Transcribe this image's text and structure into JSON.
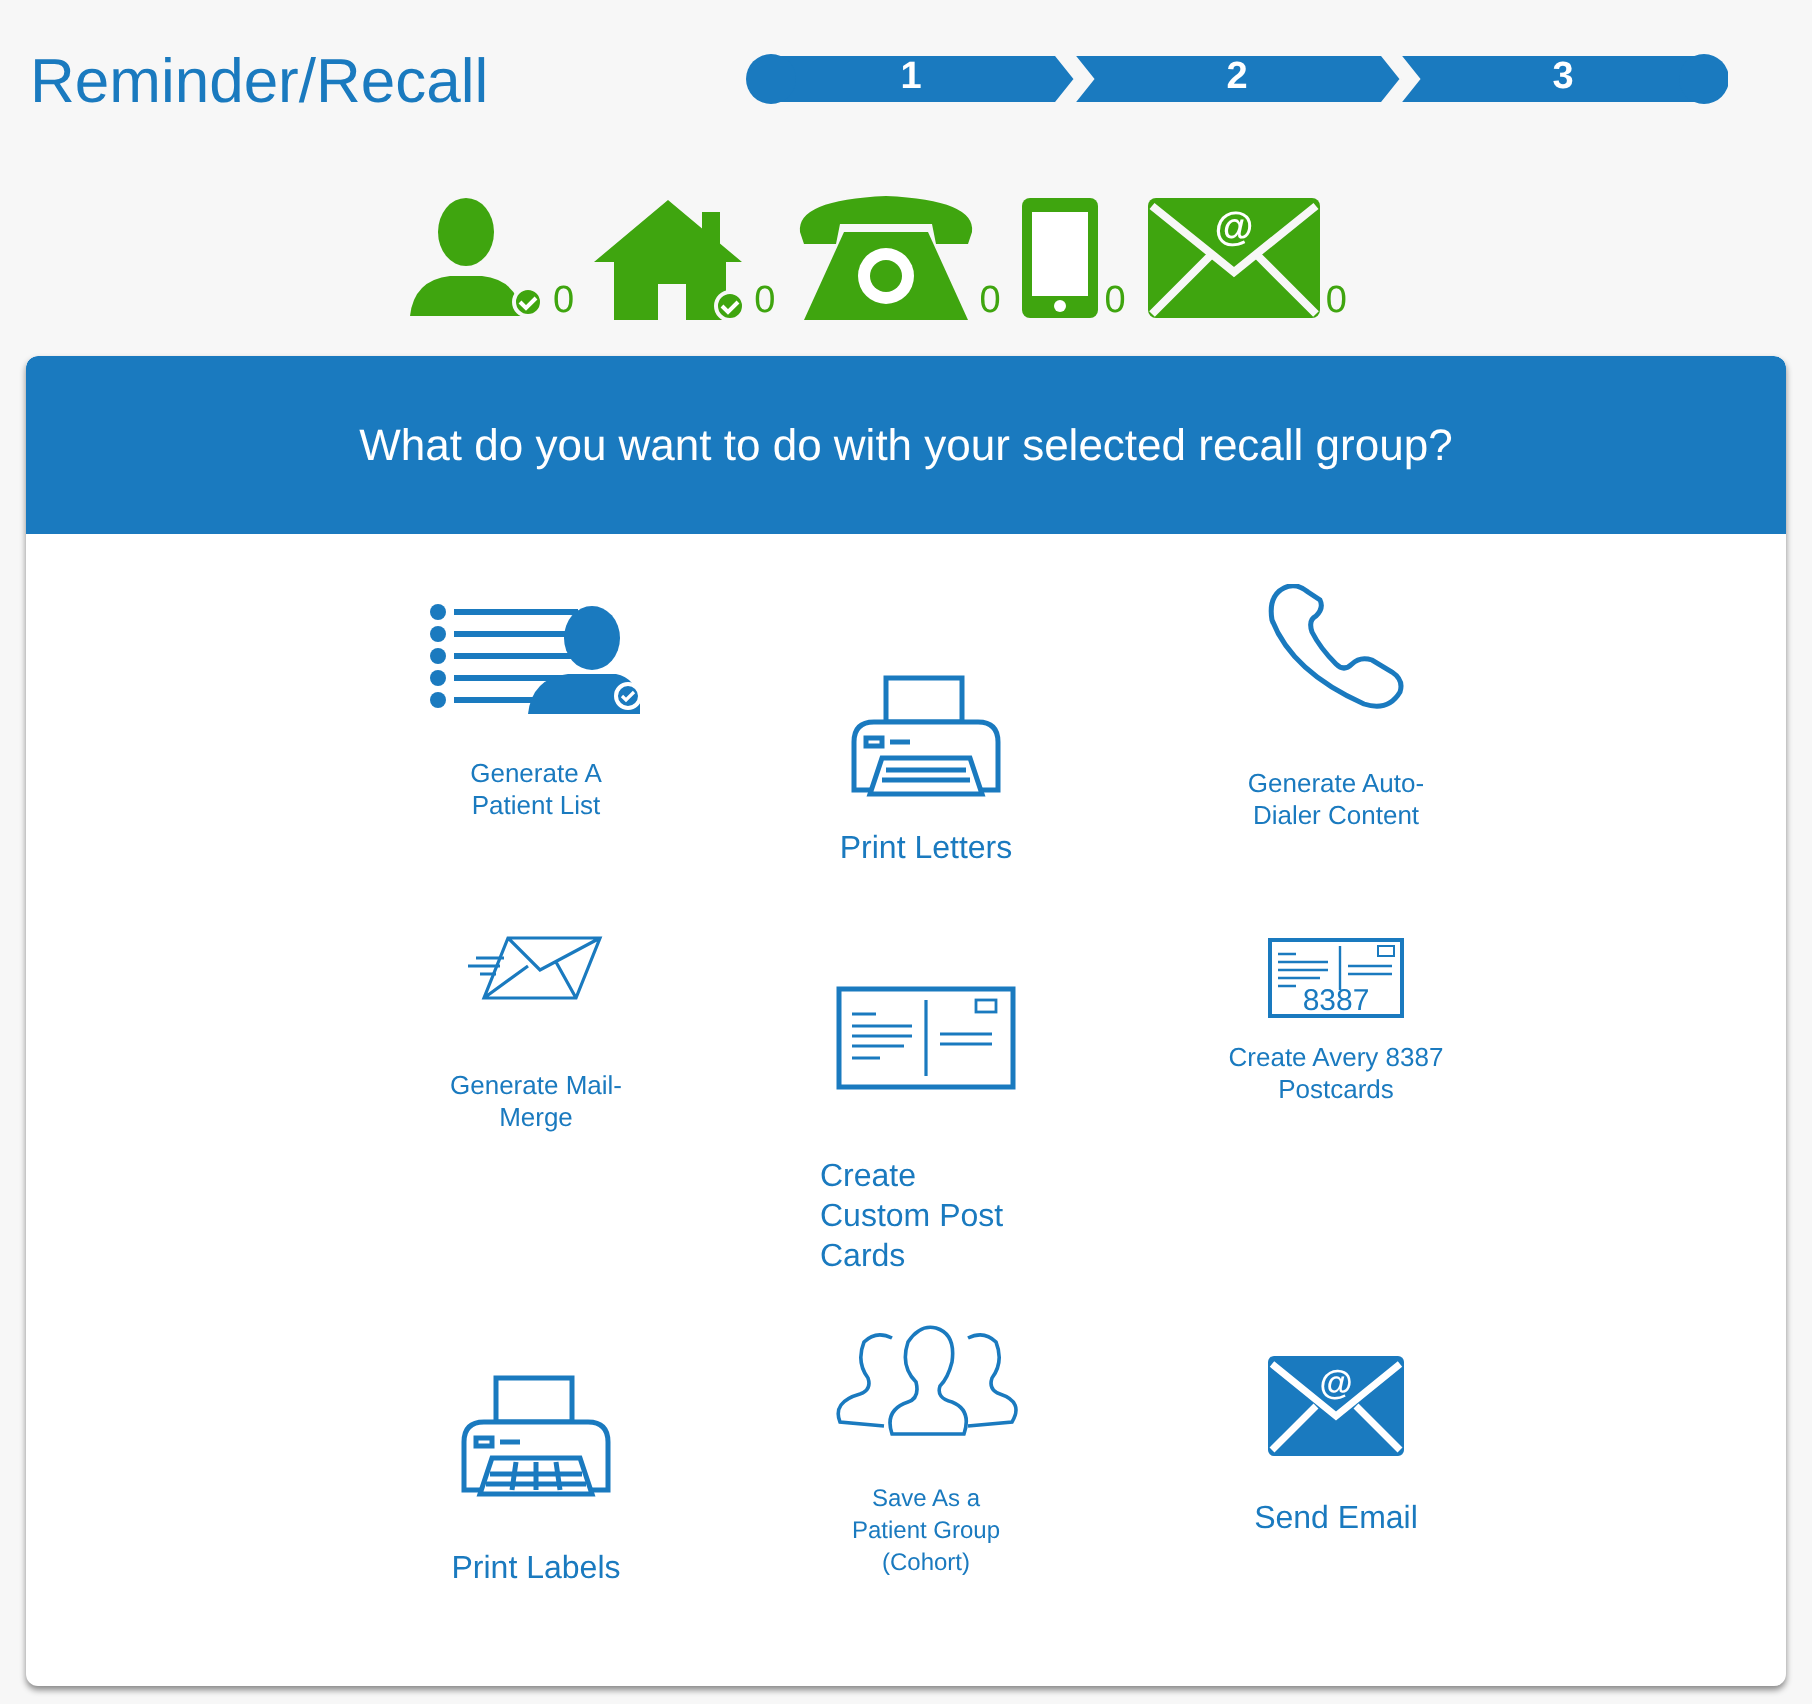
{
  "title": "Reminder/Recall",
  "steps": [
    "1",
    "2",
    "3"
  ],
  "contact_counts": [
    {
      "kind": "person",
      "count": "0"
    },
    {
      "kind": "home",
      "count": "0"
    },
    {
      "kind": "phone",
      "count": "0"
    },
    {
      "kind": "mobile",
      "count": "0"
    },
    {
      "kind": "email",
      "count": "0",
      "icon_text": "@"
    }
  ],
  "panel": {
    "heading": "What do you want to do with your selected recall group?",
    "actions": [
      {
        "kind": "patient-list",
        "label": "Generate A Patient List"
      },
      {
        "kind": "print-letters",
        "label": "Print Letters"
      },
      {
        "kind": "auto-dialer",
        "label": "Generate Auto-Dialer Content"
      },
      {
        "kind": "mail-merge",
        "label": "Generate Mail-Merge"
      },
      {
        "kind": "custom-postcards",
        "label": "Create Custom Post Cards"
      },
      {
        "kind": "avery-postcards",
        "label": "Create Avery 8387 Postcards",
        "icon_text": "8387"
      },
      {
        "kind": "print-labels",
        "label": "Print Labels"
      },
      {
        "kind": "cohort",
        "label": "Save As a Patient Group (Cohort)"
      },
      {
        "kind": "send-email",
        "label": "Send Email",
        "icon_text": "@"
      }
    ]
  }
}
